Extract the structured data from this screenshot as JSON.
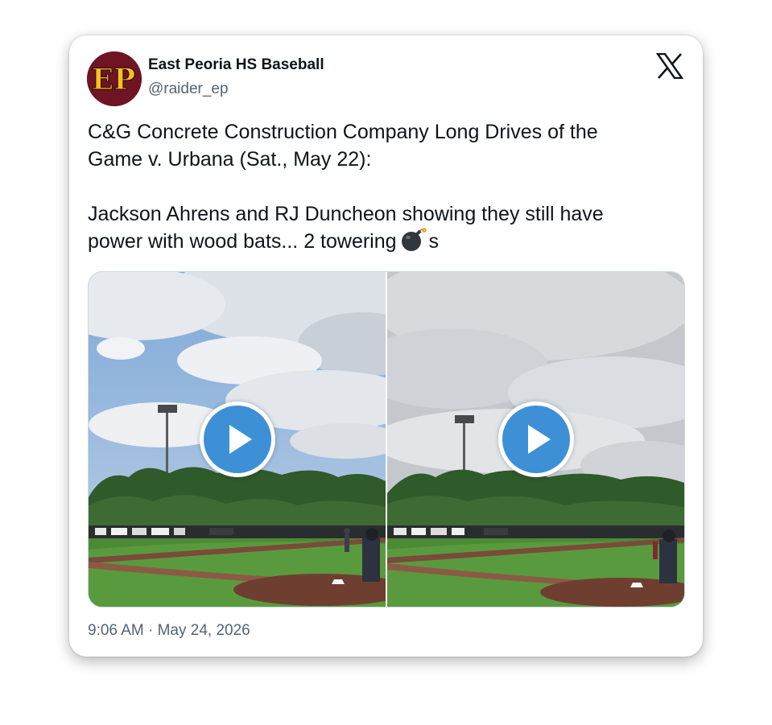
{
  "tweet": {
    "author": {
      "name": "East Peoria HS Baseball",
      "handle": "@raider_ep",
      "avatar_text": "EP",
      "avatar_colors": {
        "background": "#6e1423",
        "letters": "#f7c21a"
      }
    },
    "platform_icon": "x-logo-icon",
    "text_lines": [
      "C&G Concrete Construction Company Long Drives of the",
      "Game v. Urbana (Sat., May 22):",
      "Jackson Ahrens and RJ Duncheon showing they still have",
      "power with wood bats... 2 towering"
    ],
    "text_suffix": "s",
    "emoji": "bomb-icon",
    "media": [
      {
        "type": "video",
        "icon": "play-icon"
      },
      {
        "type": "video",
        "icon": "play-icon"
      }
    ],
    "timestamp": "9:06 AM · May 24, 2026"
  },
  "colors": {
    "text": "#0f1419",
    "secondary_text": "#536471",
    "play_button": "#3d90d6"
  }
}
